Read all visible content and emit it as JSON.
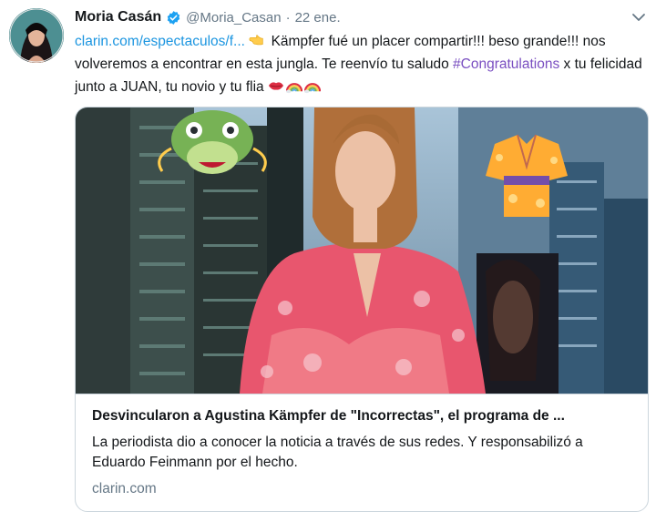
{
  "tweet": {
    "author_name": "Moria Casán",
    "handle": "@Moria_Casan",
    "separator": "·",
    "date": "22 ene.",
    "text": {
      "link": "clarin.com/espectaculos/f...",
      "part1": " Kämpfer fué un placer compartir!!! beso grande!!! nos volveremos a encontrar en esta jungla. Te reenvío tu saludo ",
      "hashtag": "#Congratulations",
      "part2": " x tu felicidad junto a JUAN, tu novio y tu flia "
    },
    "emojis": [
      "pointing-hand",
      "kiss-lips",
      "rainbow",
      "rainbow"
    ]
  },
  "card": {
    "title": "Desvincularon a Agustina Kämpfer de \"Incorrectas\", el programa de ...",
    "description": "La periodista dio a conocer la noticia a través de sus redes. Y responsabilizó a Eduardo Feinmann por el hecho.",
    "domain": "clarin.com",
    "image_stickers": [
      "dragon-emoji",
      "kimono-emoji"
    ]
  },
  "colors": {
    "link": "#1b95e0",
    "hashtag": "#7a4fc1",
    "secondary_text": "#657786",
    "border": "#ccd6dd",
    "verified": "#1da1f2"
  }
}
